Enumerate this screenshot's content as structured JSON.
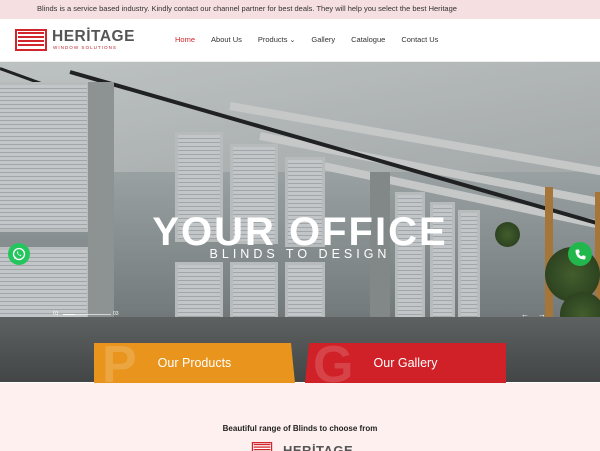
{
  "topbar": {
    "message": "Blinds is a service based industry. Kindly contact our channel partner for best deals. They will help you select the best Heritage"
  },
  "brand": {
    "name": "HERİTAGE",
    "sub": "WINDOW SOLUTIONS",
    "color": "#d2262d"
  },
  "nav": {
    "home": "Home",
    "about": "About Us",
    "products": "Products",
    "gallery": "Gallery",
    "catalogue": "Catalogue",
    "contact": "Contact Us"
  },
  "hero": {
    "subtitle": "BLINDS TO DESIGN",
    "title": "YOUR OFFICE",
    "slide_current": "01",
    "slide_total": "03"
  },
  "cards": {
    "products": {
      "label": "Our Products",
      "ghost": "P",
      "color": "#e8941d"
    },
    "gallery": {
      "label": "Our Gallery",
      "ghost": "G",
      "color": "#cf2127"
    }
  },
  "section": {
    "tagline": "Beautiful range of Blinds to choose from"
  },
  "icons": {
    "whatsapp": "whatsapp-icon",
    "phone": "phone-icon",
    "prev": "arrow-left-icon",
    "next": "arrow-right-icon",
    "dropdown": "chevron-down-icon"
  }
}
